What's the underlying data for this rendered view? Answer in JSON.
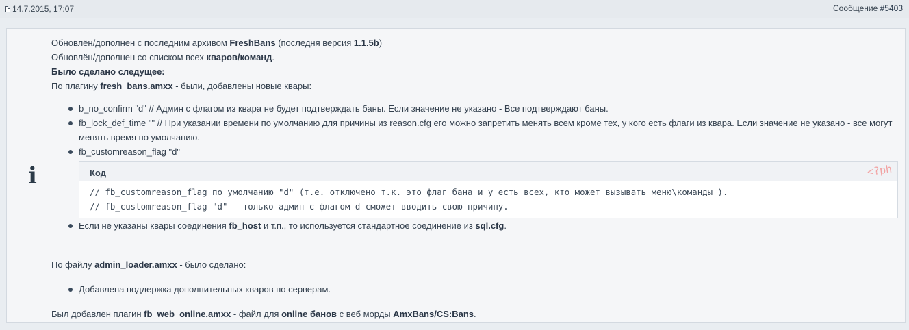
{
  "header": {
    "date": "14.7.2015, 17:07",
    "message_label": "Сообщение ",
    "message_number": "#5403"
  },
  "post": {
    "icon": "info-icon",
    "l1_a": "Обновлён/дополнен с последним архивом ",
    "l1_b": "FreshBans",
    "l1_c": " (последня версия ",
    "l1_d": "1.1.5b",
    "l1_e": ")",
    "l2_a": "Обновлён/дополнен со списком всех ",
    "l2_b": "кваров/команд",
    "l2_c": ".",
    "l3": "Было сделано следущее:",
    "l4_a": "По плагину ",
    "l4_b": "fresh_bans.amxx",
    "l4_c": " - были, добавлены новые квары:",
    "items": [
      "b_no_confirm \"d\" // Админ с флагом из квара не будет подтверждать баны. Если значение не указано - Все подтверждают баны.",
      "fb_lock_def_time \"\" // При указании времени по умолчанию для причины из reason.cfg его можно запретить менять всем кроме тех, у кого есть флаги из квара. Если значение не указано - все могут менять время по умолчанию.",
      "fb_customreason_flag \"d\""
    ],
    "code": {
      "label": "Код",
      "lang": "<?ph",
      "lines": [
        "// fb_customreason_flag по умолчанию \"d\" (т.е. отключено т.к. это флаг бана и у есть всех, кто может вызывать меню\\команды ).",
        "// fb_customreason_flag \"d\" - только админ с флагом d сможет вводить свою причину."
      ]
    },
    "item4_a": "Если не указаны квары соединения ",
    "item4_b": "fb_host",
    "item4_c": " и т.п., то используется стандартное соединение из ",
    "item4_d": "sql.cfg",
    "item4_e": ".",
    "l5_a": "По файлу ",
    "l5_b": "admin_loader.amxx",
    "l5_c": " - было сделано:",
    "item5": "Добавлена поддержка дополнительных кваров по серверам.",
    "l6_a": "Был добавлен плагин ",
    "l6_b": "fb_web_online.amxx",
    "l6_c": " - файл для ",
    "l6_d": "online банов",
    "l6_e": " с веб морды ",
    "l6_f": "AmxBans/CS:Bans",
    "l6_g": "."
  }
}
